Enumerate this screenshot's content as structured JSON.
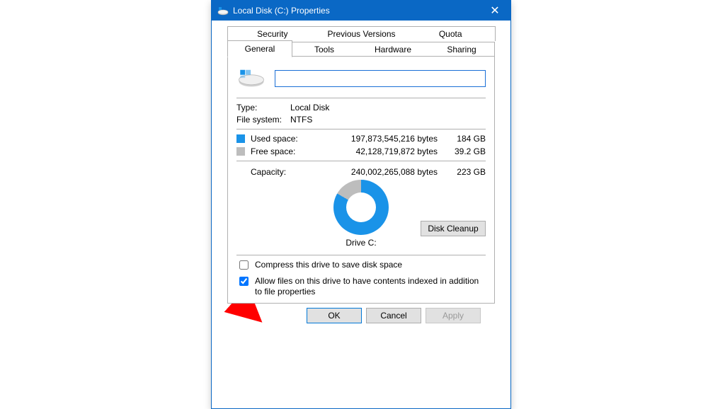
{
  "title": "Local Disk (C:) Properties",
  "tabs": {
    "row1": [
      "Security",
      "Previous Versions",
      "Quota"
    ],
    "row2": [
      "General",
      "Tools",
      "Hardware",
      "Sharing"
    ],
    "active": "General"
  },
  "general": {
    "volume_name": "",
    "type_label": "Type:",
    "type_value": "Local Disk",
    "fs_label": "File system:",
    "fs_value": "NTFS",
    "used_label": "Used space:",
    "used_bytes": "197,873,545,216 bytes",
    "used_gb": "184 GB",
    "free_label": "Free space:",
    "free_bytes": "42,128,719,872 bytes",
    "free_gb": "39.2 GB",
    "cap_label": "Capacity:",
    "cap_bytes": "240,002,265,088 bytes",
    "cap_gb": "223 GB",
    "drive_caption": "Drive C:",
    "cleanup_label": "Disk Cleanup",
    "compress_label": "Compress this drive to save disk space",
    "index_label": "Allow files on this drive to have contents indexed in addition to file properties"
  },
  "buttons": {
    "ok": "OK",
    "cancel": "Cancel",
    "apply": "Apply"
  },
  "colors": {
    "used": "#1a93e8",
    "free": "#bdbdbd",
    "accent": "#0a68c5"
  }
}
